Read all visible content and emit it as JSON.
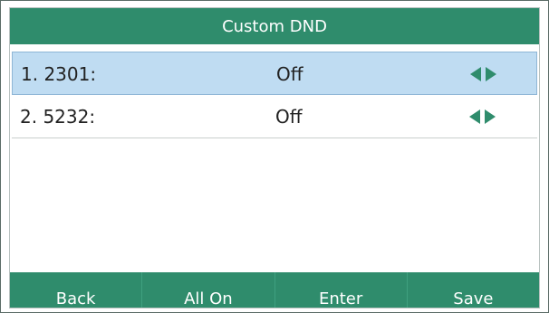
{
  "title": "Custom DND",
  "rows": [
    {
      "label": "1. 2301:",
      "value": "Off",
      "selected": true
    },
    {
      "label": "2. 5232:",
      "value": "Off",
      "selected": false
    }
  ],
  "softkeys": [
    "Back",
    "All On",
    "Enter",
    "Save"
  ],
  "colors": {
    "accent": "#2f8c6c",
    "selected_row": "#bfdcf2"
  },
  "icons": [
    "arrow-left-icon",
    "arrow-right-icon"
  ]
}
